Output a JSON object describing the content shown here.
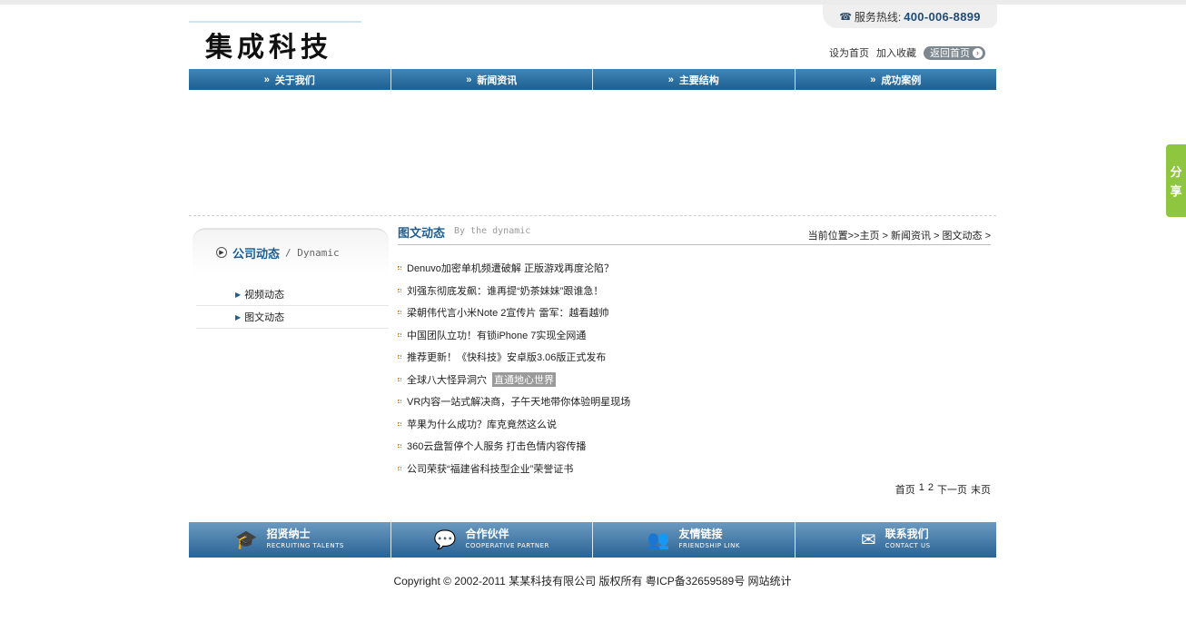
{
  "header": {
    "hotline_label": "服务热线:",
    "hotline_number": "400-006-8899",
    "logo_text": "集成科技",
    "set_home": "设为首页",
    "add_favorite": "加入收藏",
    "back_home": "返回首页"
  },
  "nav": {
    "items": [
      {
        "label": "关于我们"
      },
      {
        "label": "新闻资讯"
      },
      {
        "label": "主要结构"
      },
      {
        "label": "成功案例"
      }
    ]
  },
  "sidebar": {
    "title": "公司动态",
    "subtitle": "/ Dynamic",
    "items": [
      {
        "label": "视频动态"
      },
      {
        "label": "图文动态"
      }
    ]
  },
  "content": {
    "title": "图文动态",
    "subtitle": "By the dynamic",
    "breadcrumb": "当前位置>>主页 > 新闻资讯 > 图文动态 >",
    "news": [
      {
        "text": "Denuvo加密单机频遭破解 正版游戏再度沦陷？",
        "highlight": ""
      },
      {
        "text": "刘强东彻底发飙：谁再提“奶茶妹妹”跟谁急！",
        "highlight": ""
      },
      {
        "text": "梁朝伟代言小米Note 2宣传片 雷军：越看越帅",
        "highlight": ""
      },
      {
        "text": "中国团队立功！有锁iPhone 7实现全网通",
        "highlight": ""
      },
      {
        "text": "推荐更新！《快科技》安卓版3.06版正式发布",
        "highlight": ""
      },
      {
        "text": "全球八大怪异洞穴",
        "highlight": "直通地心世界"
      },
      {
        "text": "VR内容一站式解决商，子午天地带你体验明星现场",
        "highlight": ""
      },
      {
        "text": "苹果为什么成功？库克竟然这么说",
        "highlight": ""
      },
      {
        "text": "360云盘暂停个人服务 打击色情内容传播",
        "highlight": ""
      },
      {
        "text": "公司荣获“福建省科技型企业”荣誉证书",
        "highlight": ""
      }
    ],
    "pager": {
      "first": "首页",
      "page1": "1",
      "page2": "2",
      "next": "下一页",
      "last": "末页"
    }
  },
  "footer_bar": {
    "items": [
      {
        "cn": "招贤纳士",
        "en": "RECRUITING TALENTS",
        "icon": "graduate-icon"
      },
      {
        "cn": "合作伙伴",
        "en": "COOPERATIVE PARTNER",
        "icon": "chat-icon"
      },
      {
        "cn": "友情链接",
        "en": "FRIENDSHIP LINK",
        "icon": "people-icon"
      },
      {
        "cn": "联系我们",
        "en": "CONTACT US",
        "icon": "envelope-icon"
      }
    ]
  },
  "copyright": "Copyright © 2002-2011 某某科技有限公司 版权所有  粤ICP备32659589号  网站统计",
  "share": {
    "line1": "分",
    "line2": "享"
  },
  "colors": {
    "nav_blue": "#1e5f92",
    "title_blue": "#1f5d8f",
    "share_green": "#8ec63f",
    "bullet_orange": "#e58a2a"
  }
}
